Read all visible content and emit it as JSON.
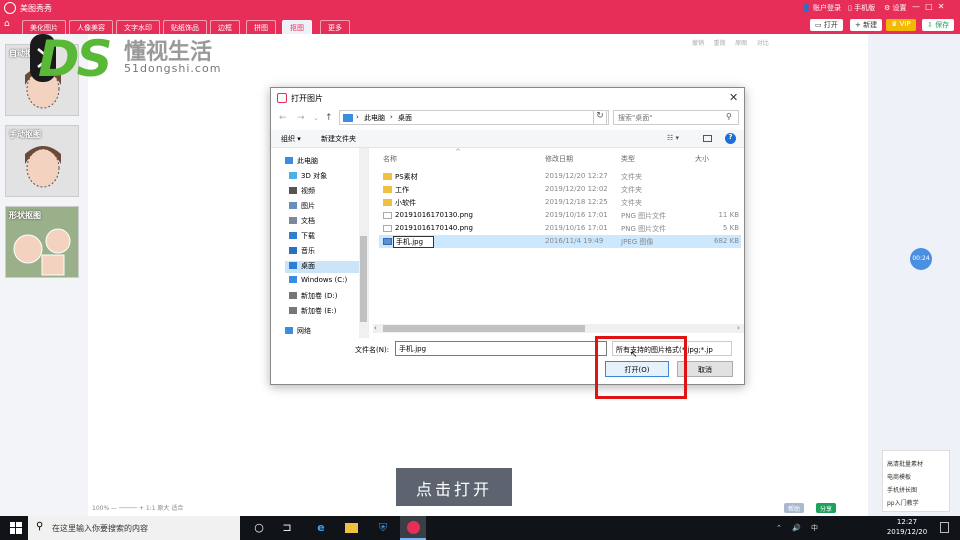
{
  "app": {
    "title": "美图秀秀",
    "account": "账户登录",
    "mobile": "手机版",
    "settings": "设置",
    "win_min": "—",
    "win_max": "□",
    "win_close": "✕",
    "accent": "#e62e58"
  },
  "nav": {
    "home_icon": "home-icon",
    "tabs": [
      "美化图片",
      "人像美容",
      "文字水印",
      "贴纸饰品",
      "边框",
      "拼图",
      "抠图",
      "更多"
    ],
    "active_tab": "抠图",
    "buttons": {
      "open": "打开",
      "new": "新建",
      "save": "保存",
      "vip": "VIP"
    }
  },
  "left_panel": {
    "cards": [
      {
        "label": "自动抠图"
      },
      {
        "label": "手动抠图"
      },
      {
        "label": "形状抠图"
      }
    ]
  },
  "canvas_tools": [
    "撤销",
    "重做",
    "原图",
    "对比"
  ],
  "watermark": {
    "logo": "DS",
    "site_name": "懂视生活",
    "url": "51dongshi.com"
  },
  "dialog": {
    "title": "打开图片",
    "close": "✕",
    "back": "←",
    "forward": "→",
    "dropdown": "⌄",
    "up": "↑",
    "path": [
      "此电脑",
      "桌面"
    ],
    "search_placeholder": "搜索\"桌面\"",
    "toolbar": {
      "organize": "组织 ▾",
      "new_folder": "新建文件夹"
    },
    "nav_items": [
      "此电脑",
      "3D 对象",
      "视频",
      "图片",
      "文档",
      "下载",
      "音乐",
      "桌面",
      "Windows (C:)",
      "新加卷 (D:)",
      "新加卷 (E:)",
      "网络"
    ],
    "selected_nav": "桌面",
    "columns": [
      "名称",
      "修改日期",
      "类型",
      "大小"
    ],
    "files": [
      {
        "name": "PS素材",
        "date": "2019/12/20 12:27",
        "type": "文件夹",
        "size": "",
        "kind": "folder"
      },
      {
        "name": "工作",
        "date": "2019/12/20 12:02",
        "type": "文件夹",
        "size": "",
        "kind": "folder"
      },
      {
        "name": "小软件",
        "date": "2019/12/18 12:25",
        "type": "文件夹",
        "size": "",
        "kind": "folder"
      },
      {
        "name": "20191016170130.png",
        "date": "2019/10/16 17:01",
        "type": "PNG 图片文件",
        "size": "11 KB",
        "kind": "png"
      },
      {
        "name": "20191016170140.png",
        "date": "2019/10/16 17:01",
        "type": "PNG 图片文件",
        "size": "5 KB",
        "kind": "png"
      },
      {
        "name": "手机.jpg",
        "date": "2016/11/4 19:49",
        "type": "JPEG 图像",
        "size": "682 KB",
        "kind": "jpg"
      }
    ],
    "selected_file": "手机.jpg",
    "filename_label": "文件名(N):",
    "filename_value": "手机.jpg",
    "filetype": "所有支持的图片格式(*.jpg;*.jp",
    "open_label": "打开(O)",
    "cancel_label": "取消"
  },
  "caption": "点击打开",
  "timer_badge": "00:24",
  "popup": [
    "高清批量素材",
    "电商模板",
    "手机拼长图",
    "pp入门教学"
  ],
  "bottom_bar": {
    "zoom": "100%  —  ─────  +   1:1 原大  适合",
    "help": "帮助",
    "share": "分享"
  },
  "taskbar": {
    "search_placeholder": "在这里输入你要搜索的内容",
    "time": "12:27",
    "date": "2019/12/20",
    "tray": "⌃ 🔊 中",
    "task_view": "⊐",
    "app_icons": [
      "cortana-icon",
      "task-view-icon",
      "edge-icon",
      "explorer-icon",
      "security-icon",
      "meitu-icon"
    ]
  }
}
